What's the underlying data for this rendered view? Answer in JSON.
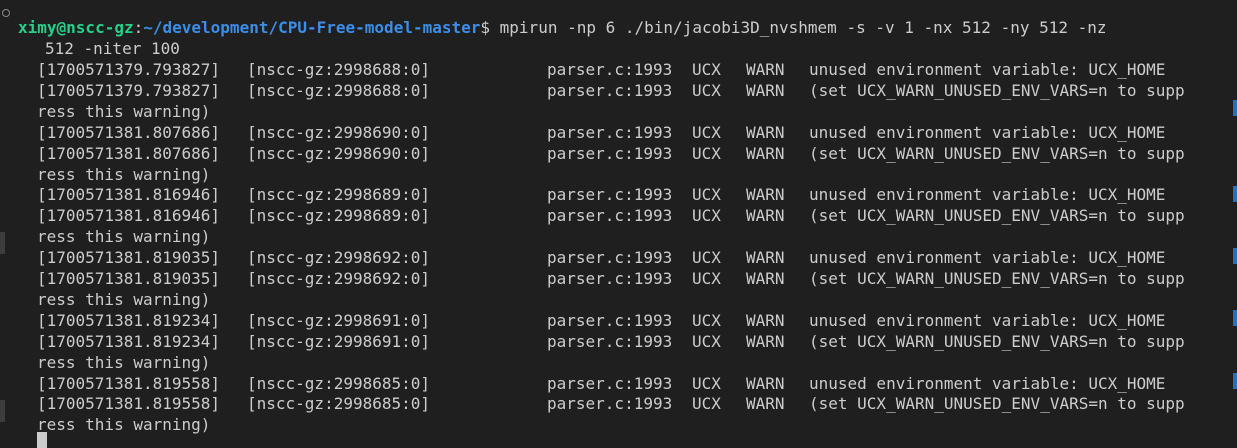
{
  "prompt": {
    "user_host": "ximy@nscc-gz",
    "separator": ":",
    "cwd": "~/development/CPU-Free-model-master",
    "symbol": "$ ",
    "command": "mpirun -np 6 ./bin/jacobi3D_nvshmem -s -v 1 -nx 512 -ny 512 -nz",
    "command_cont": "512 -niter 100"
  },
  "log": [
    {
      "ts": "[1700571379.793827]",
      "host": "[nscc-gz:2998688:0]",
      "src": "parser.c:1993",
      "lib": "UCX",
      "level": "WARN",
      "msg": "unused environment variable: UCX_HOME"
    },
    {
      "ts": "[1700571379.793827]",
      "host": "[nscc-gz:2998688:0]",
      "src": "parser.c:1993",
      "lib": "UCX",
      "level": "WARN",
      "msg": "(set UCX_WARN_UNUSED_ENV_VARS=n to supp",
      "cont": "ress this warning)"
    },
    {
      "ts": "[1700571381.807686]",
      "host": "[nscc-gz:2998690:0]",
      "src": "parser.c:1993",
      "lib": "UCX",
      "level": "WARN",
      "msg": "unused environment variable: UCX_HOME"
    },
    {
      "ts": "[1700571381.807686]",
      "host": "[nscc-gz:2998690:0]",
      "src": "parser.c:1993",
      "lib": "UCX",
      "level": "WARN",
      "msg": "(set UCX_WARN_UNUSED_ENV_VARS=n to supp",
      "cont": "ress this warning)"
    },
    {
      "ts": "[1700571381.816946]",
      "host": "[nscc-gz:2998689:0]",
      "src": "parser.c:1993",
      "lib": "UCX",
      "level": "WARN",
      "msg": "unused environment variable: UCX_HOME"
    },
    {
      "ts": "[1700571381.816946]",
      "host": "[nscc-gz:2998689:0]",
      "src": "parser.c:1993",
      "lib": "UCX",
      "level": "WARN",
      "msg": "(set UCX_WARN_UNUSED_ENV_VARS=n to supp",
      "cont": "ress this warning)"
    },
    {
      "ts": "[1700571381.819035]",
      "host": "[nscc-gz:2998692:0]",
      "src": "parser.c:1993",
      "lib": "UCX",
      "level": "WARN",
      "msg": "unused environment variable: UCX_HOME"
    },
    {
      "ts": "[1700571381.819035]",
      "host": "[nscc-gz:2998692:0]",
      "src": "parser.c:1993",
      "lib": "UCX",
      "level": "WARN",
      "msg": "(set UCX_WARN_UNUSED_ENV_VARS=n to supp",
      "cont": "ress this warning)"
    },
    {
      "ts": "[1700571381.819234]",
      "host": "[nscc-gz:2998691:0]",
      "src": "parser.c:1993",
      "lib": "UCX",
      "level": "WARN",
      "msg": "unused environment variable: UCX_HOME"
    },
    {
      "ts": "[1700571381.819234]",
      "host": "[nscc-gz:2998691:0]",
      "src": "parser.c:1993",
      "lib": "UCX",
      "level": "WARN",
      "msg": "(set UCX_WARN_UNUSED_ENV_VARS=n to supp",
      "cont": "ress this warning)"
    },
    {
      "ts": "[1700571381.819558]",
      "host": "[nscc-gz:2998685:0]",
      "src": "parser.c:1993",
      "lib": "UCX",
      "level": "WARN",
      "msg": "unused environment variable: UCX_HOME"
    },
    {
      "ts": "[1700571381.819558]",
      "host": "[nscc-gz:2998685:0]",
      "src": "parser.c:1993",
      "lib": "UCX",
      "level": "WARN",
      "msg": "(set UCX_WARN_UNUSED_ENV_VARS=n to supp",
      "cont": "ress this warning)"
    }
  ],
  "colors": {
    "background": "#1f1f1f",
    "text": "#cccccc",
    "user_host": "#23d18b",
    "path": "#3b8eea",
    "scrollbar_marker": "#2f6fb0"
  },
  "icons": {
    "prompt_status": "circle-outline-icon",
    "cursor": "block-cursor"
  }
}
